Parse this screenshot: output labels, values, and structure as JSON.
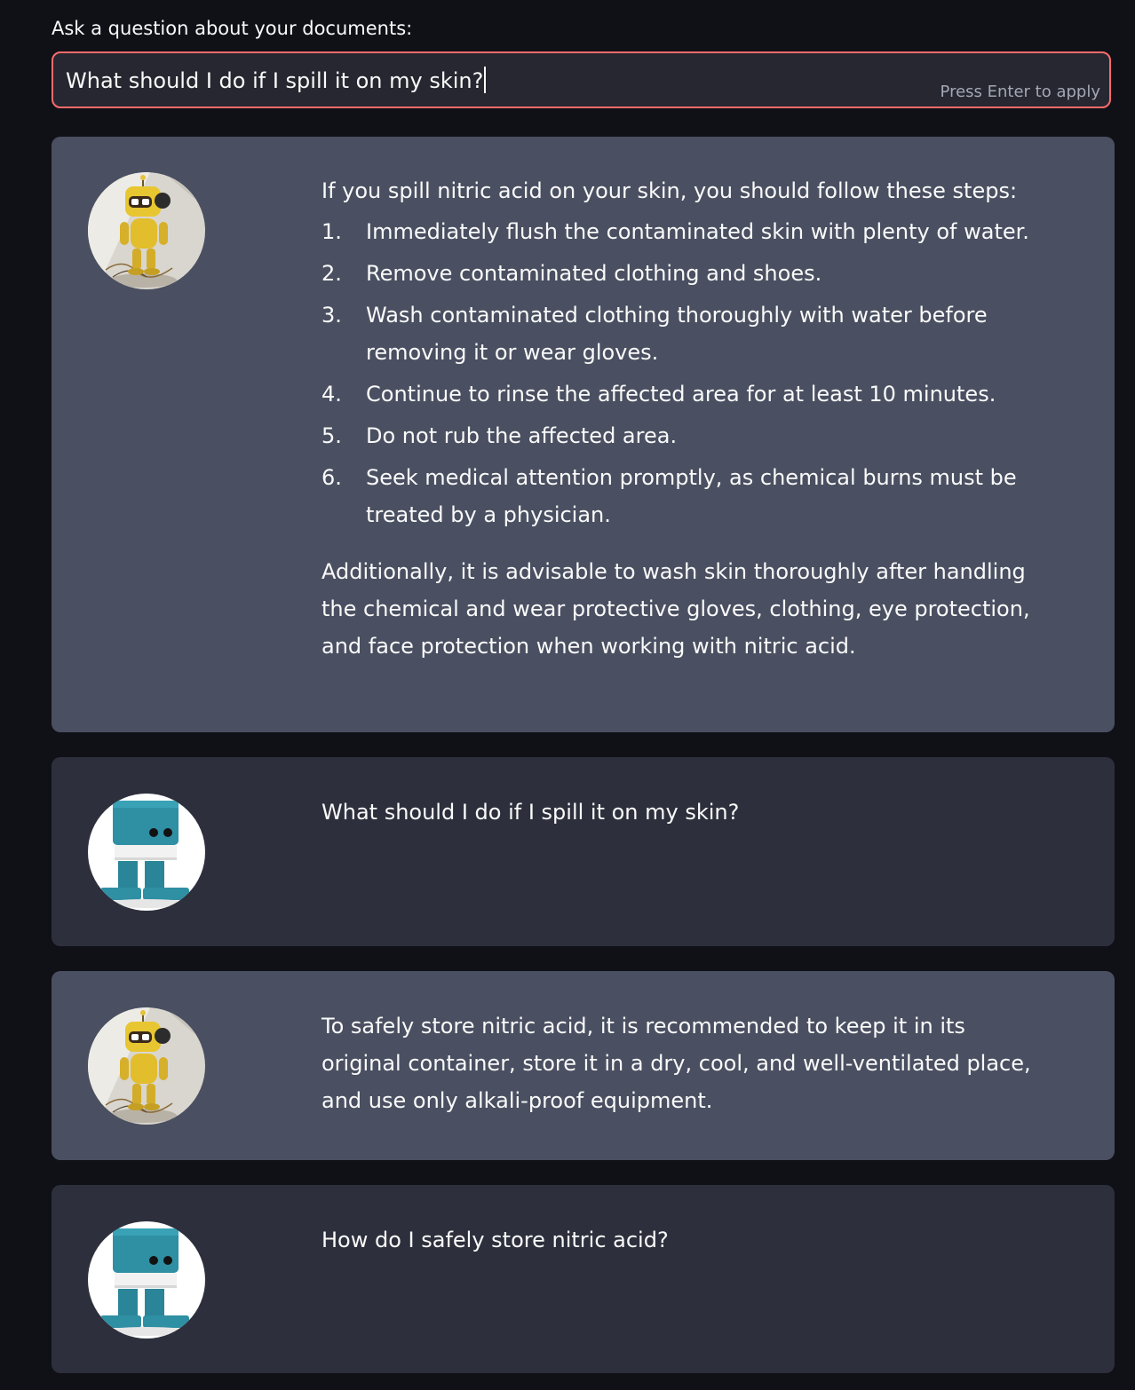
{
  "question": {
    "label": "Ask a question about your documents:",
    "value": "What should I do if I spill it on my skin?",
    "hint": "Press Enter to apply"
  },
  "messages": [
    {
      "role": "bot",
      "avatar": "yellow-robot-avatar",
      "intro": "If you spill nitric acid on your skin, you should follow these steps:",
      "steps": [
        {
          "num": "1.",
          "text": "Immediately flush the contaminated skin with plenty of water."
        },
        {
          "num": "2.",
          "text": "Remove contaminated clothing and shoes."
        },
        {
          "num": "3.",
          "text": "Wash contaminated clothing thoroughly with water before removing it or wear gloves."
        },
        {
          "num": "4.",
          "text": "Continue to rinse the affected area for at least 10 minutes."
        },
        {
          "num": "5.",
          "text": "Do not rub the affected area."
        },
        {
          "num": "6.",
          "text": "Seek medical attention promptly, as chemical burns must be treated by a physician."
        }
      ],
      "outro": "Additionally, it is advisable to wash skin thoroughly after handling the chemical and wear protective gloves, clothing, eye protection, and face protection when working with nitric acid."
    },
    {
      "role": "user",
      "avatar": "teal-robot-avatar",
      "text": "What should I do if I spill it on my skin?"
    },
    {
      "role": "bot",
      "avatar": "yellow-robot-avatar",
      "text": "To safely store nitric acid, it is recommended to keep it in its original container, store it in a dry, cool, and well-ventilated place, and use only alkali-proof equipment."
    },
    {
      "role": "user",
      "avatar": "teal-robot-avatar",
      "text": "How do I safely store nitric acid?"
    }
  ],
  "colors": {
    "background": "#0f1117",
    "bot_bubble": "#4a5061",
    "user_bubble": "#2d303c",
    "input_border": "#ff6b6b"
  }
}
